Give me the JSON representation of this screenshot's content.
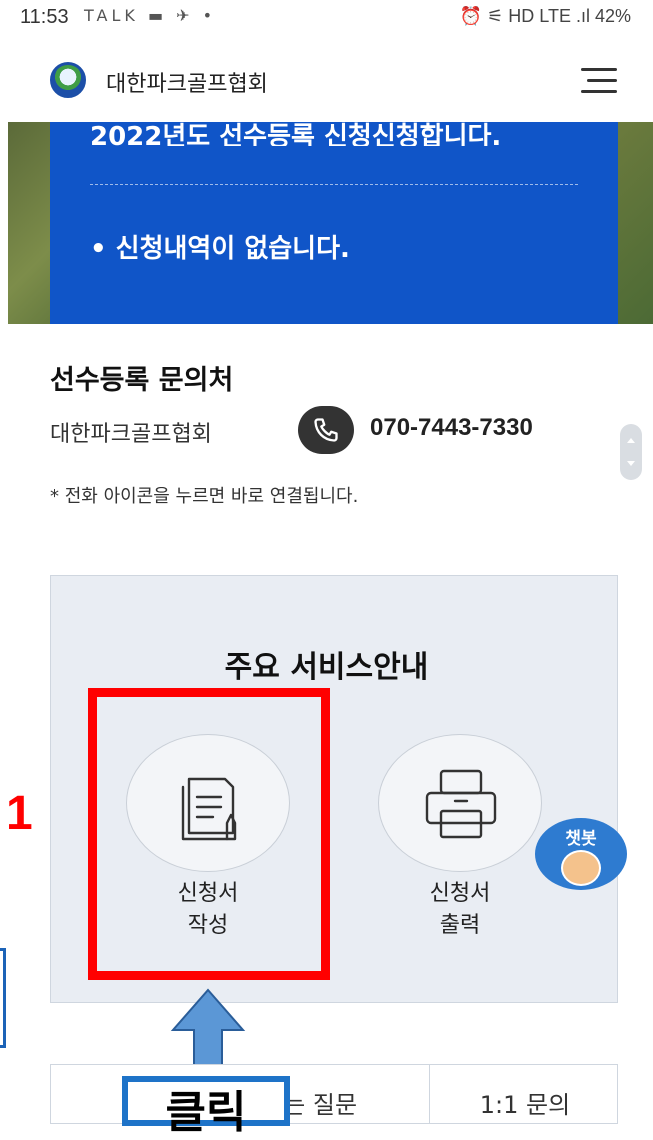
{
  "status_bar": {
    "time": "11:53",
    "left_icons": "TALK ▬ ✈ •",
    "right_status": "⏰ ⚟ HD LTE .ıl 42%"
  },
  "header": {
    "site_title": "대한파크골프협회"
  },
  "hero": {
    "cut_text": "2022년도 선수등록 신청신청합니다.",
    "bullet_text": "• 신청내역이 없습니다."
  },
  "inquiry": {
    "title": "선수등록 문의처",
    "organization": "대한파크골프협회",
    "phone": "070-7443-7330",
    "note": "* 전화 아이콘을 누르면 바로 연결됩니다."
  },
  "services": {
    "title": "주요 서비스안내",
    "items": [
      {
        "label": "신청서\n작성",
        "icon": "document-pen-icon"
      },
      {
        "label": "신청서\n출력",
        "icon": "printer-icon"
      }
    ]
  },
  "annotations": {
    "step_number": "1",
    "click_text": "클릭"
  },
  "chatbot": {
    "label": "챗봇"
  },
  "bottom_table": {
    "cell1": "공지사항 자주하는 질문",
    "cell2": "1:1 문의"
  },
  "colors": {
    "hero_blue": "#1055c8",
    "highlight_red": "#ff0000",
    "arrow_blue": "#5b97d6",
    "chatbot_blue": "#2e7bd0"
  }
}
